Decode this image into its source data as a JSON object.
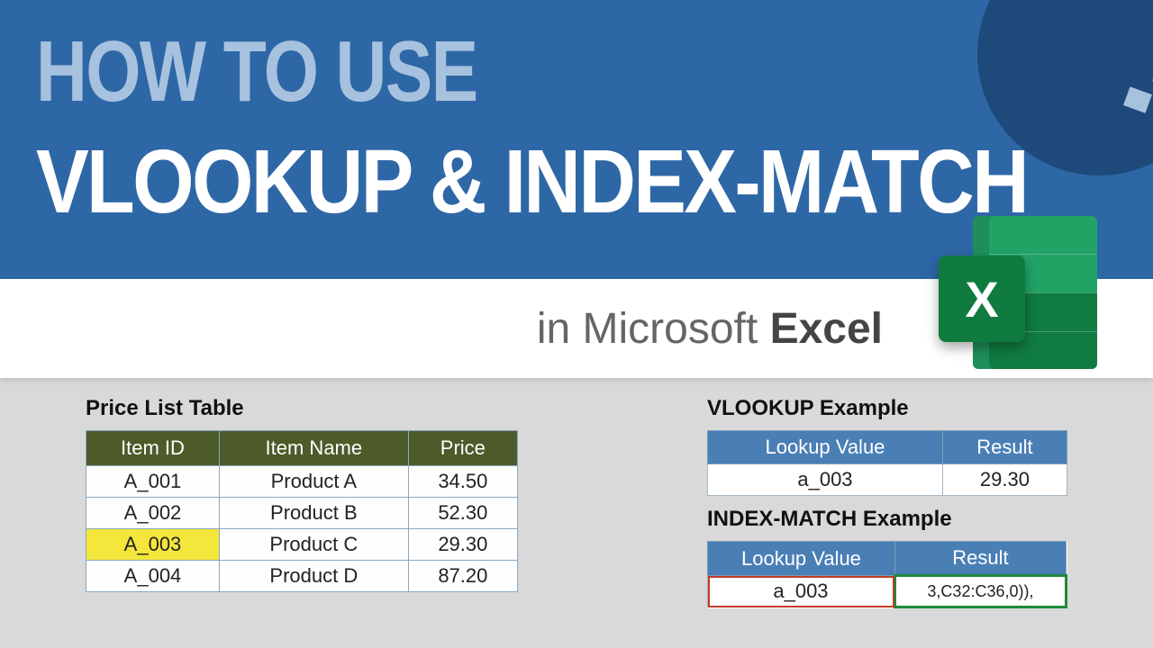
{
  "banner": {
    "line1": "HOW TO USE",
    "line2": "VLOOKUP & INDEX-MATCH"
  },
  "subtitle": {
    "prefix": "in Microsoft ",
    "strong": "Excel"
  },
  "excel_icon_letter": "X",
  "price_table": {
    "title": "Price List Table",
    "headers": [
      "Item ID",
      "Item Name",
      "Price"
    ],
    "rows": [
      {
        "id": "A_001",
        "name": "Product A",
        "price": "34.50",
        "hi": false
      },
      {
        "id": "A_002",
        "name": "Product B",
        "price": "52.30",
        "hi": false
      },
      {
        "id": "A_003",
        "name": "Product C",
        "price": "29.30",
        "hi": true
      },
      {
        "id": "A_004",
        "name": "Product D",
        "price": "87.20",
        "hi": false
      }
    ]
  },
  "vlookup": {
    "title": "VLOOKUP Example",
    "headers": [
      "Lookup Value",
      "Result"
    ],
    "lookup": "a_003",
    "result": "29.30"
  },
  "index_match": {
    "title": "INDEX-MATCH Example",
    "headers": [
      "Lookup Value",
      "Result"
    ],
    "lookup": "a_003",
    "result": "3,C32:C36,0)),"
  }
}
